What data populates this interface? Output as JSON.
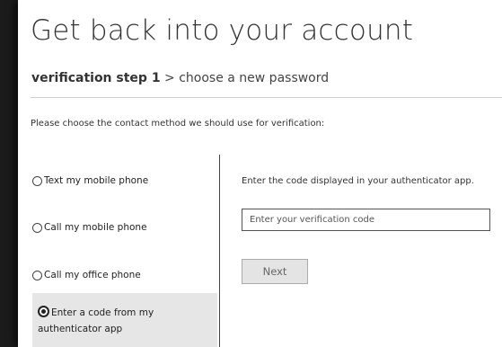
{
  "page": {
    "title": "Get back into your account"
  },
  "steps": {
    "active": "verification step 1",
    "separator": ">",
    "next": "choose a new password"
  },
  "instructions": "Please choose the contact method we should use for verification:",
  "methods": [
    {
      "label": "Text my mobile phone",
      "selected": false
    },
    {
      "label": "Call my mobile phone",
      "selected": false
    },
    {
      "label": "Call my office phone",
      "selected": false
    },
    {
      "label": "Enter a code from my authenticator app",
      "selected": true
    }
  ],
  "authenticator": {
    "hint": "Enter the code displayed in your authenticator app.",
    "input_placeholder": "Enter your verification code",
    "input_value": "",
    "next_label": "Next"
  },
  "colors": {
    "background": "#ffffff",
    "selected_row": "#e6e6e6",
    "text": "#333333",
    "button": "#e4e4e4"
  }
}
